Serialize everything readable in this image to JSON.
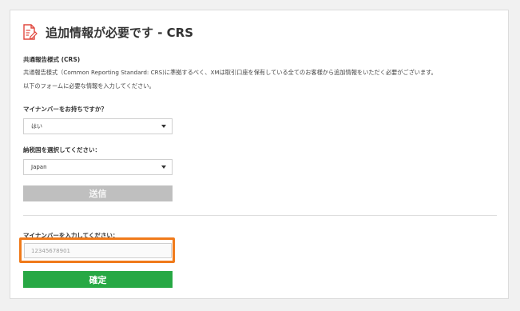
{
  "page": {
    "title": "追加情報が必要です - CRS",
    "crs_heading": "共通報告様式 (CRS)",
    "crs_description": "共通報告様式（Common Reporting Standard: CRS)に準拠するべく、XMは取引口座を保有している全てのお客様から追加情報をいただく必要がございます。",
    "form_instruction": "以下のフォームに必要な情報を入力してください。"
  },
  "form": {
    "mynumber_question": "マイナンバーをお持ちですか？",
    "mynumber_selected": "はい",
    "tax_country_label": "納税国を選択してください：",
    "tax_country_selected": "Japan",
    "submit_label": "送信"
  },
  "mynumber": {
    "label": "マイナンバーを入力してください：",
    "placeholder": "12345678901",
    "confirm_label": "確定"
  },
  "colors": {
    "accent_highlight": "#f07a1a",
    "confirm_green": "#27a844",
    "disabled_gray": "#bfbfbf",
    "icon_red": "#e0483e"
  }
}
